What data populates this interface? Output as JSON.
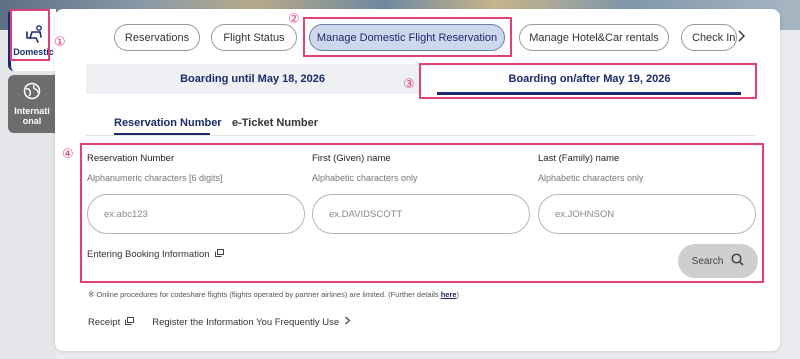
{
  "side_nav": {
    "domestic_label": "Domestic",
    "international_label": "Internati onal"
  },
  "top_tabs": [
    {
      "label": "Reservations"
    },
    {
      "label": "Flight Status"
    },
    {
      "label": "Manage Domestic Flight Reservation"
    },
    {
      "label": "Manage Hotel&Car rentals"
    },
    {
      "label": "Check In"
    }
  ],
  "date_tabs": {
    "until": "Boarding until May 18, 2026",
    "after": "Boarding on/after May 19, 2026"
  },
  "sub_tabs": {
    "reservation_number": "Reservation Number",
    "eticket_number": "e-Ticket Number"
  },
  "form": {
    "reservation": {
      "label": "Reservation Number",
      "hint": "Alphanumeric characters [6 digits]",
      "placeholder": "ex.abc123"
    },
    "first_name": {
      "label": "First (Given) name",
      "hint": "Alphabetic characters only",
      "placeholder": "ex.DAVIDSCOTT"
    },
    "last_name": {
      "label": "Last (Family) name",
      "hint": "Alphabetic characters only",
      "placeholder": "ex.JOHNSON"
    },
    "booking_info": "Entering Booking Information",
    "search": "Search"
  },
  "footnote": {
    "text": "※ Online procedures for codeshare flights (flights operated by partner airlines) are limited. (Further details ",
    "link": "here",
    "close": ")"
  },
  "links": {
    "receipt": "Receipt",
    "register": "Register the Information You Frequently Use"
  },
  "markers": [
    "①",
    "②",
    "③",
    "④"
  ],
  "colors": {
    "brand": "#1a2a6c",
    "highlight": "#e0407a",
    "active_pill": "#cdd8ee",
    "search_button": "#cfcfcf"
  }
}
